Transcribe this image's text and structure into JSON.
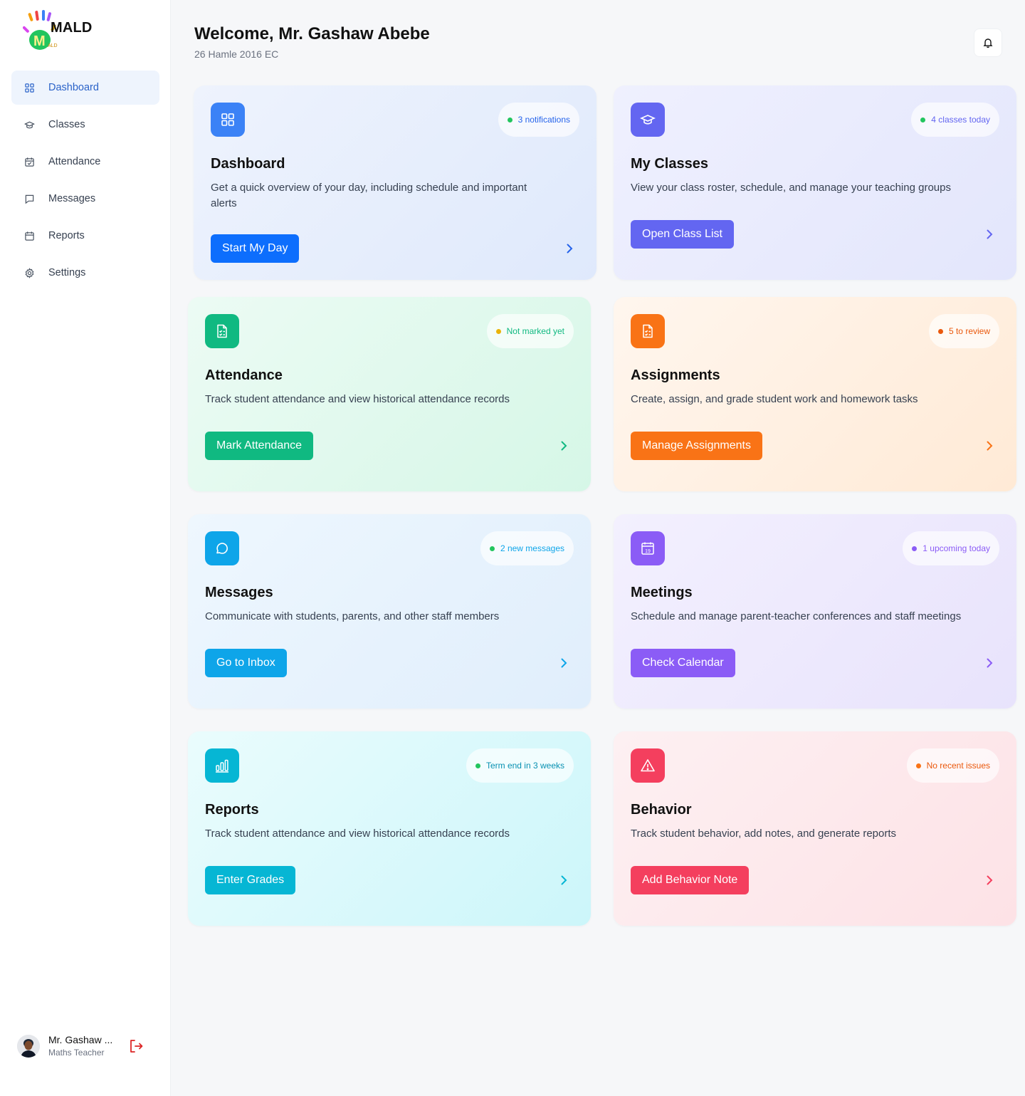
{
  "app": {
    "name": "MALD",
    "logo_text": "MALD"
  },
  "sidebar": {
    "items": [
      {
        "label": "Dashboard",
        "icon": "grid-icon",
        "active": true
      },
      {
        "label": "Classes",
        "icon": "graduation-cap-icon"
      },
      {
        "label": "Attendance",
        "icon": "calendar-check-icon"
      },
      {
        "label": "Messages",
        "icon": "message-icon"
      },
      {
        "label": "Reports",
        "icon": "calendar-icon"
      },
      {
        "label": "Settings",
        "icon": "gear-icon"
      }
    ]
  },
  "user": {
    "name": "Mr. Gashaw ...",
    "role": "Maths Teacher"
  },
  "header": {
    "welcome": "Welcome, Mr. Gashaw Abebe",
    "date": "26 Hamle 2016 EC"
  },
  "cards": [
    {
      "title": "Dashboard",
      "desc_1": "Get a quick overview of your day, including schedule and important",
      "desc_2": "alerts",
      "badge": "3 notifications",
      "button": "Start My Day",
      "accent": "#3b82f6",
      "button_color": "#0d6efd",
      "badge_color": "#2563eb",
      "dot_color": "#22c55e"
    },
    {
      "title": "My Classes",
      "desc_1": "View your class roster, schedule, and manage your teaching groups",
      "badge": "4 classes today",
      "button": "Open Class List",
      "accent": "#6366f1",
      "button_color": "#6366f1",
      "badge_color": "#6366f1",
      "dot_color": "#22c55e"
    },
    {
      "title": "Attendance",
      "desc_1": "Track student attendance and view historical attendance records",
      "badge": "Not marked yet",
      "button": "Mark Attendance",
      "accent": "#10b981",
      "button_color": "#10b981",
      "badge_color": "#10b981",
      "dot_color": "#eab308"
    },
    {
      "title": "Assignments",
      "desc_1": "Create, assign, and grade student work and homework tasks",
      "badge": "5 to review",
      "button": "Manage Assignments",
      "accent": "#f97316",
      "button_color": "#f97316",
      "badge_color": "#ea580c",
      "dot_color": "#ea580c"
    },
    {
      "title": "Messages",
      "desc_1": "Communicate with students, parents, and other staff members",
      "badge": "2 new messages",
      "button": "Go to Inbox",
      "accent": "#0ea5e9",
      "button_color": "#0ea5e9",
      "badge_color": "#0ea5e9",
      "dot_color": "#22c55e"
    },
    {
      "title": "Meetings",
      "desc_1": "Schedule and manage parent-teacher conferences and staff meetings",
      "badge": "1 upcoming today",
      "button": "Check Calendar",
      "accent": "#8b5cf6",
      "button_color": "#8b5cf6",
      "badge_color": "#8b5cf6",
      "dot_color": "#8b5cf6"
    },
    {
      "title": "Reports",
      "desc_1": "Track student attendance and view historical attendance records",
      "badge": "Term end in 3 weeks",
      "button": "Enter Grades",
      "accent": "#06b6d4",
      "button_color": "#06b6d4",
      "badge_color": "#0891b2",
      "dot_color": "#22c55e"
    },
    {
      "title": "Behavior",
      "desc_1": "Track student behavior, add notes, and generate reports",
      "badge": "No recent issues",
      "button": "Add Behavior Note",
      "accent": "#f43f5e",
      "button_color": "#f43f5e",
      "badge_color": "#ea580c",
      "dot_color": "#f97316"
    }
  ],
  "meeting_icon_day": "19"
}
